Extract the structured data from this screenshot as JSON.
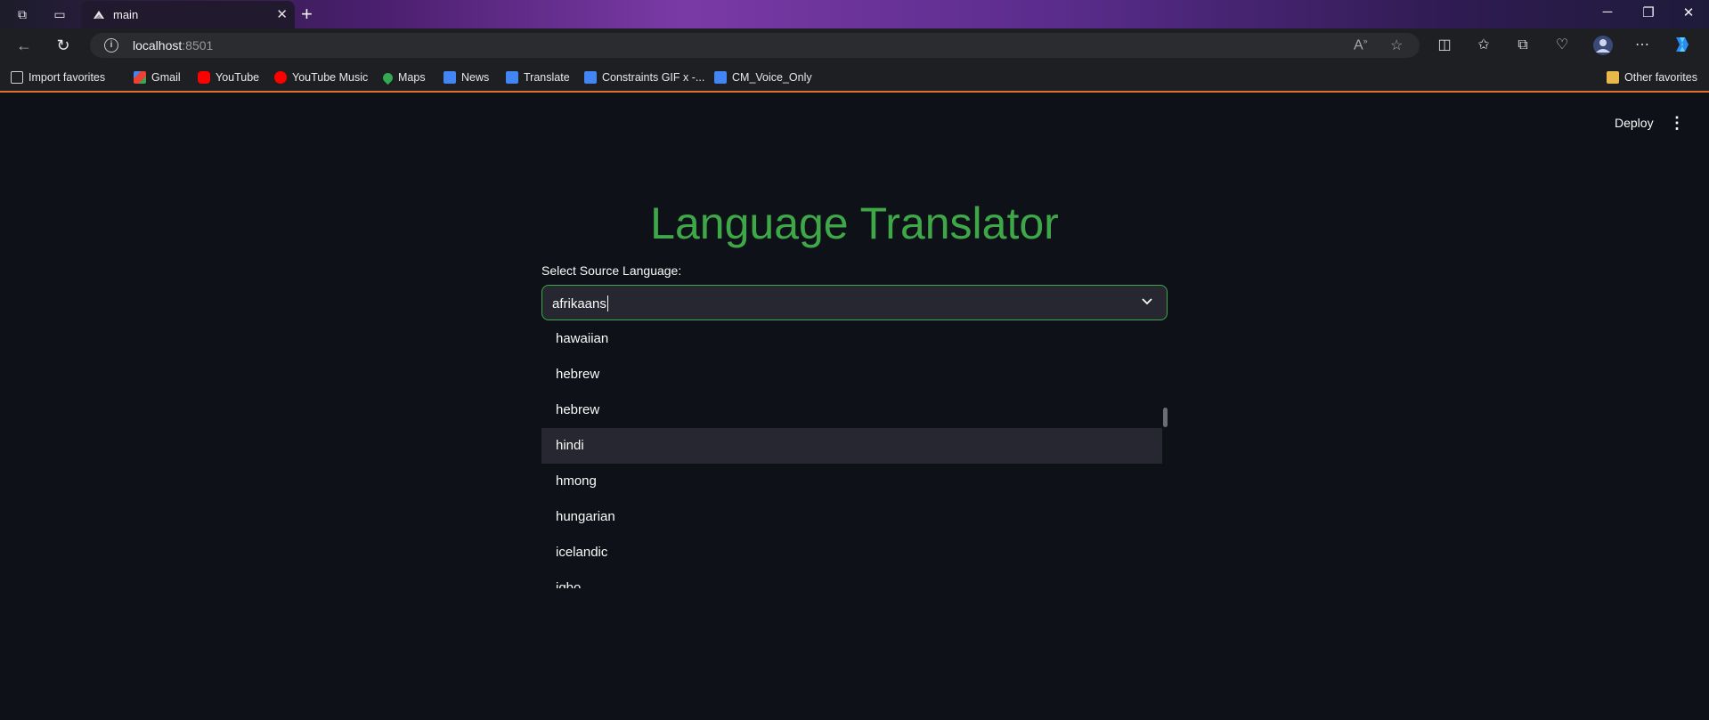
{
  "browser": {
    "tab_title": "main",
    "url_host": "localhost",
    "url_port": ":8501",
    "bookmarks": [
      {
        "label": "Import favorites",
        "icon": "import-icon"
      },
      {
        "label": "Gmail",
        "icon": "gmail-icon",
        "color": "#ea4335"
      },
      {
        "label": "YouTube",
        "icon": "youtube-icon",
        "color": "#ff0000"
      },
      {
        "label": "YouTube Music",
        "icon": "youtube-music-icon",
        "color": "#ff0000"
      },
      {
        "label": "Maps",
        "icon": "maps-icon",
        "color": "#34a853"
      },
      {
        "label": "News",
        "icon": "news-icon",
        "color": "#4285f4"
      },
      {
        "label": "Translate",
        "icon": "translate-icon",
        "color": "#4285f4"
      },
      {
        "label": "Constraints GIF x -...",
        "icon": "docs-icon",
        "color": "#4285f4"
      },
      {
        "label": "CM_Voice_Only",
        "icon": "docs-icon",
        "color": "#4285f4"
      }
    ],
    "other_favorites": "Other favorites"
  },
  "app": {
    "deploy_label": "Deploy",
    "title": "Language Translator",
    "source_label": "Select Source Language:",
    "source_value": "afrikaans",
    "options": [
      "hawaiian",
      "hebrew",
      "hebrew",
      "hindi",
      "hmong",
      "hungarian",
      "icelandic",
      "igbo"
    ],
    "highlighted_option": "hindi",
    "accent_color": "#3ea848"
  }
}
